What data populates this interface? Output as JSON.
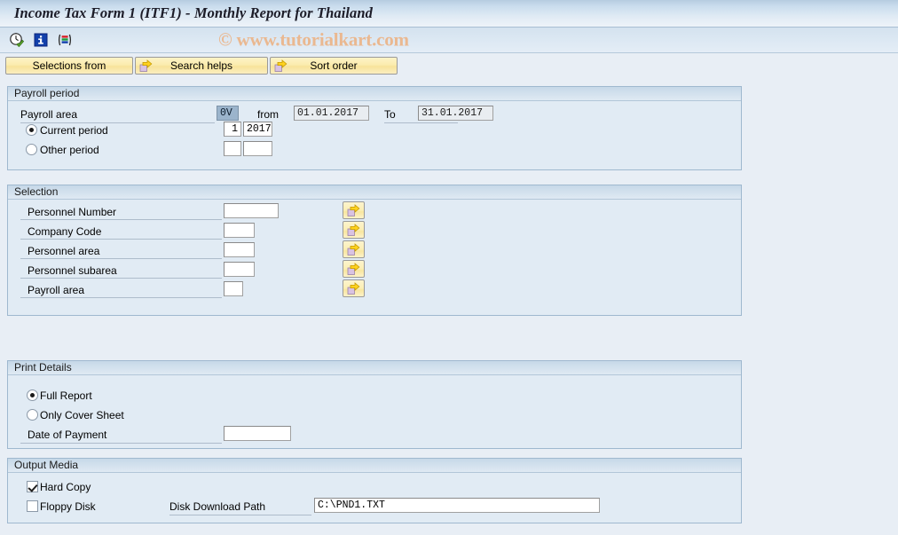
{
  "window": {
    "title": "Income Tax Form 1 (ITF1) - Monthly Report for Thailand"
  },
  "toolbar": {
    "icons": [
      {
        "name": "execute-clock-icon",
        "tooltip": "Execute"
      },
      {
        "name": "info-icon",
        "tooltip": "Information"
      },
      {
        "name": "selection-variant-icon",
        "tooltip": "Selection"
      }
    ],
    "watermark": "© www.tutorialkart.com"
  },
  "button_bar": {
    "buttons": [
      {
        "label": "Selections from",
        "icon": null
      },
      {
        "label": "Search helps",
        "icon": "yellow-arrow-icon"
      },
      {
        "label": "Sort order",
        "icon": "yellow-arrow-icon"
      }
    ]
  },
  "payroll_period": {
    "header": "Payroll period",
    "payroll_area_label": "Payroll area",
    "payroll_area_value": "0V",
    "from_label": "from",
    "from_value": "01.01.2017",
    "to_label": "To",
    "to_value": "31.01.2017",
    "current_period_label": "Current period",
    "current_period_selected": true,
    "current_period_number": "1",
    "current_period_year": "2017",
    "other_period_label": "Other period",
    "other_period_selected": false,
    "other_period_number": "",
    "other_period_year": ""
  },
  "selection": {
    "header": "Selection",
    "rows": [
      {
        "label": "Personnel Number",
        "value": "",
        "field_width": 62,
        "button_icon": "yellow-arrow-icon"
      },
      {
        "label": "Company Code",
        "value": "",
        "field_width": 35,
        "button_icon": "yellow-arrow-icon"
      },
      {
        "label": "Personnel area",
        "value": "",
        "field_width": 35,
        "button_icon": "yellow-arrow-icon"
      },
      {
        "label": "Personnel subarea",
        "value": "",
        "field_width": 35,
        "button_icon": "yellow-arrow-icon"
      },
      {
        "label": "Payroll area",
        "value": "",
        "field_width": 22,
        "button_icon": "yellow-arrow-icon"
      }
    ]
  },
  "print_details": {
    "header": "Print Details",
    "full_report_label": "Full Report",
    "full_report_selected": true,
    "only_cover_sheet_label": "Only Cover Sheet",
    "only_cover_sheet_selected": false,
    "date_of_payment_label": "Date of Payment",
    "date_of_payment_value": ""
  },
  "output_media": {
    "header": "Output Media",
    "hard_copy_label": "Hard Copy",
    "hard_copy_checked": true,
    "floppy_disk_label": "Floppy Disk",
    "floppy_disk_checked": false,
    "disk_download_path_label": "Disk Download Path",
    "disk_download_path_value": "C:\\PND1.TXT"
  },
  "colors": {
    "page_background": "#e8eef5",
    "group_background": "#e1ebf4",
    "button_yellow": "#fbecae",
    "selected_field": "#9bb4cc",
    "watermark": "#eab890"
  }
}
